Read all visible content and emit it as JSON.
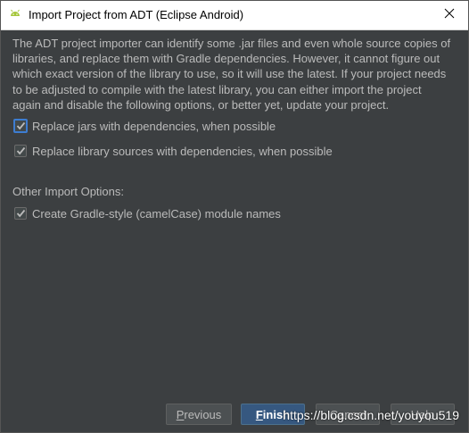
{
  "window": {
    "title": "Import Project from ADT (Eclipse Android)",
    "app_icon": "android-icon",
    "close_icon": "close-icon"
  },
  "description": "The ADT project importer can identify some .jar files and even whole source copies of libraries, and replace them with Gradle dependencies. However, it cannot figure out which exact version of the library to use, so it will use the latest. If your project needs to be adjusted to compile with the latest library, you can either import the project again and disable the following options, or better yet, update your project.",
  "options": [
    {
      "label": "Replace jars with dependencies, when possible",
      "checked": true
    },
    {
      "label": "Replace library sources with dependencies, when possible",
      "checked": true
    }
  ],
  "other_section": {
    "label": "Other Import Options:",
    "options": [
      {
        "label": "Create Gradle-style (camelCase) module names",
        "checked": true
      }
    ]
  },
  "buttons": {
    "previous": {
      "mnemonic": "P",
      "rest": "revious"
    },
    "finish": {
      "mnemonic": "F",
      "rest": "inish"
    },
    "cancel": "Cancel",
    "help": "Help"
  },
  "watermark": "https://blog.csdn.net/youyou519",
  "colors": {
    "background": "#3c3f41",
    "text": "#bbbbbb",
    "accent": "#365880",
    "checkmark": "#bbbbbb",
    "focus": "#3d7dd1",
    "android_green": "#a4c639"
  }
}
